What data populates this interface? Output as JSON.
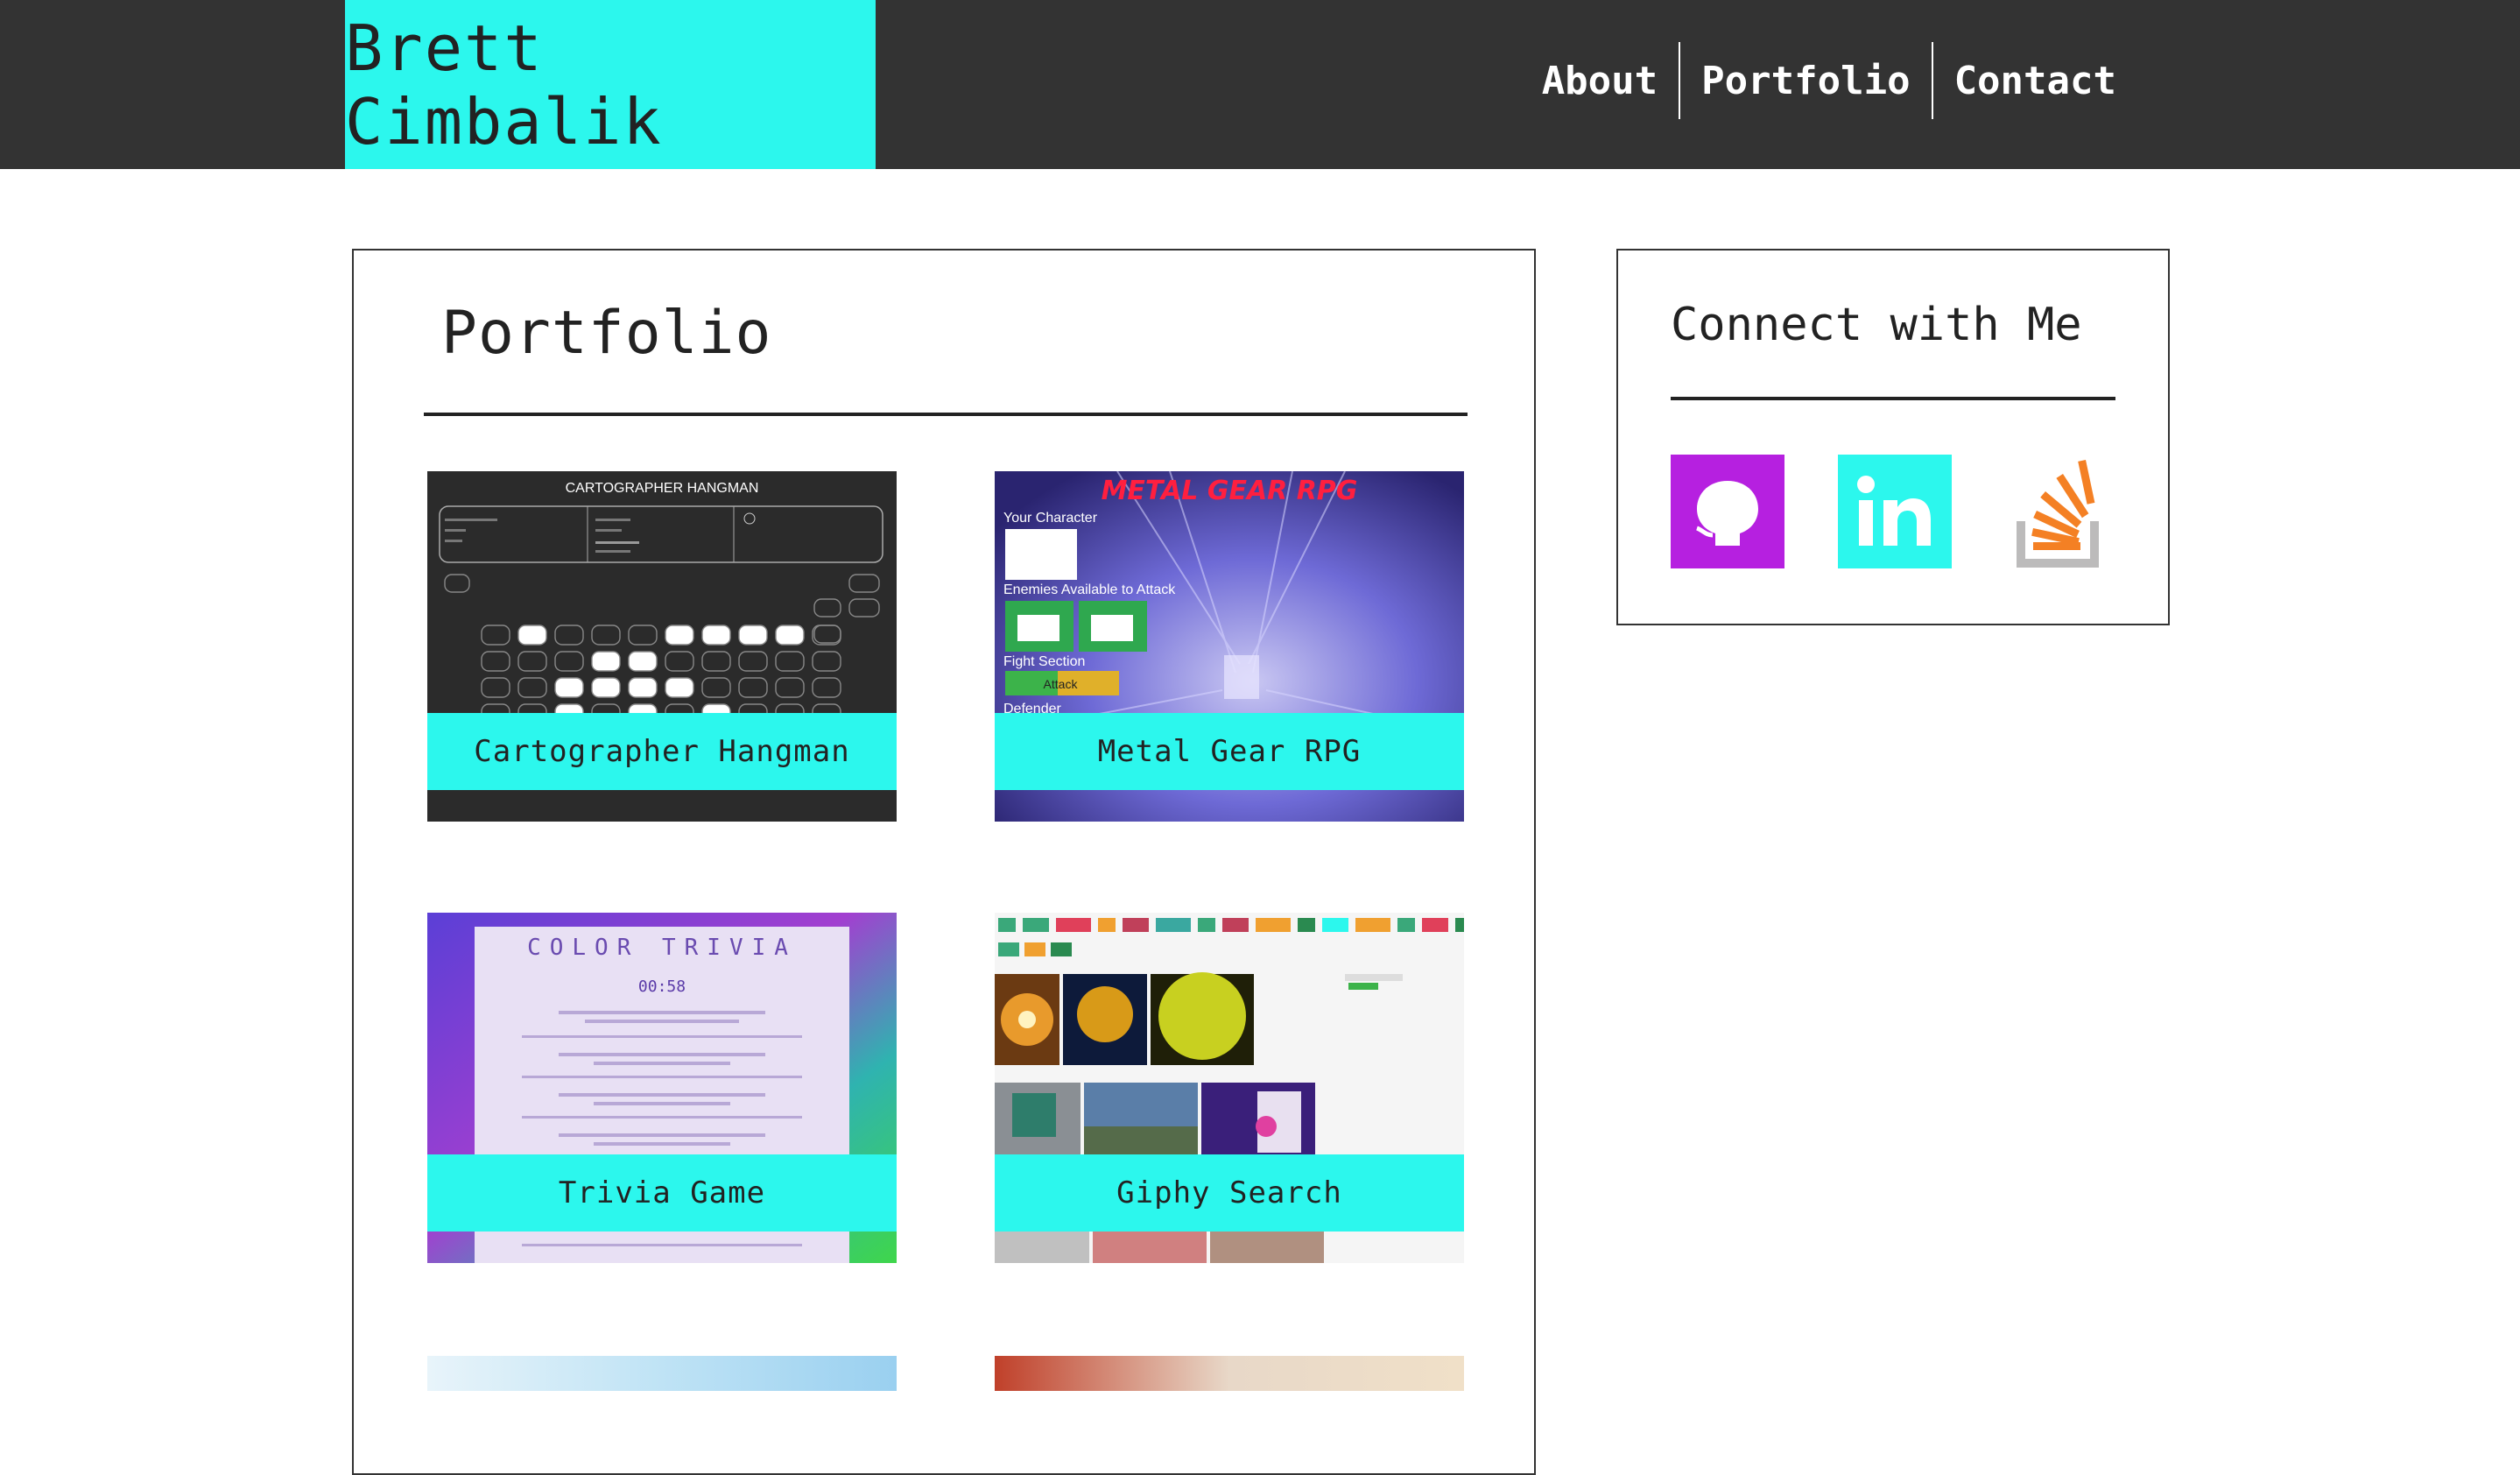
{
  "header": {
    "brand": "Brett Cimbalik",
    "nav": [
      {
        "label": "About"
      },
      {
        "label": "Portfolio"
      },
      {
        "label": "Contact"
      }
    ]
  },
  "portfolio": {
    "title": "Portfolio",
    "projects": [
      {
        "label": "Cartographer Hangman",
        "thumb_title": "CARTOGRAPHER HANGMAN"
      },
      {
        "label": "Metal Gear RPG",
        "thumb_title": "METAL GEAR RPG",
        "thumb_lines": [
          "Your Character",
          "Enemies Available to Attack",
          "Fight Section",
          "Attack",
          "Defender"
        ]
      },
      {
        "label": "Trivia Game",
        "thumb_title": "COLOR TRIVIA",
        "thumb_timer": "00:58"
      },
      {
        "label": "Giphy Search"
      }
    ]
  },
  "connect": {
    "title": "Connect with Me",
    "links": [
      {
        "name": "github",
        "color": "#b620e0"
      },
      {
        "name": "linkedin",
        "color": "#2cf7ed"
      },
      {
        "name": "stackoverflow",
        "color": "#f48024"
      }
    ]
  },
  "colors": {
    "accent": "#2cf7ed",
    "header_bg": "#333333"
  }
}
